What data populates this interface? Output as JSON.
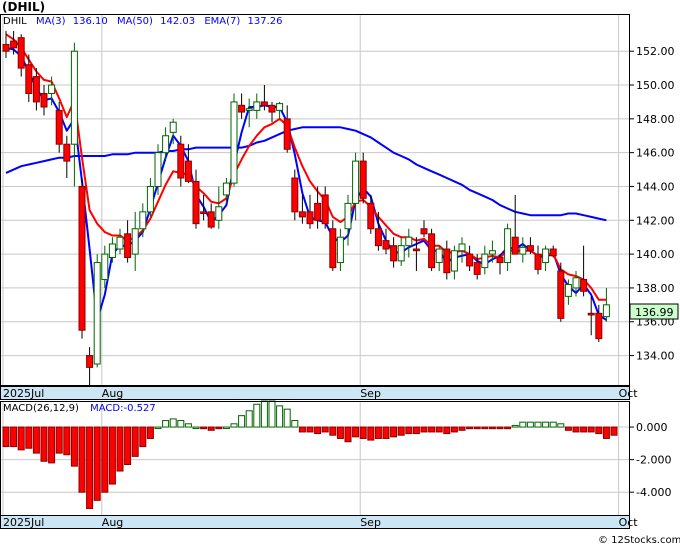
{
  "title": "(DHIL)",
  "footer": "© 12Stocks.com",
  "colors": {
    "ma3": "#0000ff",
    "ma50": "#0000ff",
    "ema7": "#ff0000",
    "up": "#006400",
    "down": "#ff0000",
    "axis_bg": "#cce6f5",
    "price_tag_bg": "#ccffcc",
    "grid": "#c8c8c8"
  },
  "legend": {
    "symbol": "DHIL",
    "ma3_label": "MA(3)",
    "ma3_value": "136.10",
    "ma50_label": "MA(50)",
    "ma50_value": "142.03",
    "ema7_label": "EMA(7)",
    "ema7_value": "137.26"
  },
  "last_price": "136.99",
  "macd_legend": {
    "label": "MACD(26,12,9)",
    "value_label": "MACD:-0.527"
  },
  "chart_data": [
    {
      "type": "candlestick",
      "title": "(DHIL)",
      "xlabel": "",
      "ylabel": "",
      "ylim": [
        132.2,
        154.2
      ],
      "y_ticks": [
        "152.00",
        "150.00",
        "148.00",
        "146.00",
        "144.00",
        "142.00",
        "140.00",
        "138.00",
        "136.00",
        "134.00"
      ],
      "x_tick_labels": [
        "2025Jul",
        "Aug",
        "Sep",
        "Oct"
      ],
      "x_tick_index": [
        0,
        13,
        47,
        81
      ],
      "grid": true,
      "ohlc": [
        [
          152.4,
          153.2,
          151.6,
          152.0
        ],
        [
          152.6,
          153.2,
          151.8,
          152.2
        ],
        [
          152.8,
          153.0,
          150.5,
          151.0
        ],
        [
          151.2,
          151.8,
          149.0,
          149.5
        ],
        [
          150.5,
          151.0,
          148.5,
          149.0
        ],
        [
          149.5,
          150.0,
          148.2,
          148.7
        ],
        [
          149.5,
          150.5,
          148.8,
          150.0
        ],
        [
          148.5,
          149.0,
          146.0,
          146.5
        ],
        [
          146.5,
          147.0,
          144.5,
          145.5
        ],
        [
          146.5,
          152.5,
          144.0,
          152.0
        ],
        [
          144.0,
          144.5,
          135.0,
          135.5
        ],
        [
          134.0,
          134.5,
          132.0,
          133.3
        ],
        [
          133.5,
          140.0,
          133.3,
          139.5
        ],
        [
          138.5,
          140.5,
          138.0,
          140.0
        ],
        [
          139.8,
          141.0,
          139.5,
          140.6
        ],
        [
          140.3,
          141.5,
          140.0,
          141.0
        ],
        [
          141.2,
          142.0,
          139.5,
          139.8
        ],
        [
          140.0,
          142.5,
          139.0,
          141.5
        ],
        [
          141.5,
          143.0,
          141.0,
          142.5
        ],
        [
          142.5,
          144.5,
          142.2,
          144.0
        ],
        [
          144.0,
          146.5,
          143.5,
          146.0
        ],
        [
          146.0,
          147.5,
          145.5,
          147.0
        ],
        [
          147.2,
          148.0,
          146.5,
          147.8
        ],
        [
          146.5,
          147.0,
          144.0,
          144.5
        ],
        [
          145.5,
          146.5,
          144.2,
          144.3
        ],
        [
          144.3,
          145.0,
          141.5,
          141.8
        ],
        [
          142.5,
          143.5,
          142.0,
          142.4
        ],
        [
          142.5,
          143.0,
          141.5,
          141.6
        ],
        [
          142.0,
          144.0,
          141.5,
          142.8
        ],
        [
          143.5,
          144.5,
          143.0,
          144.2
        ],
        [
          144.2,
          149.5,
          144.0,
          149.0
        ],
        [
          148.8,
          149.5,
          148.0,
          148.4
        ],
        [
          148.5,
          149.2,
          147.5,
          148.6
        ],
        [
          148.5,
          149.5,
          148.0,
          149.0
        ],
        [
          149.0,
          150.0,
          148.5,
          148.8
        ],
        [
          148.8,
          149.0,
          147.8,
          148.4
        ],
        [
          148.5,
          149.0,
          148.0,
          148.9
        ],
        [
          148.0,
          148.8,
          146.0,
          146.2
        ],
        [
          144.5,
          145.0,
          142.0,
          142.5
        ],
        [
          142.5,
          143.5,
          141.8,
          142.2
        ],
        [
          142.5,
          143.5,
          141.5,
          141.8
        ],
        [
          143.0,
          144.0,
          141.5,
          142.0
        ],
        [
          143.5,
          144.0,
          141.5,
          141.8
        ],
        [
          141.5,
          142.0,
          139.0,
          139.2
        ],
        [
          139.5,
          141.5,
          139.0,
          141.0
        ],
        [
          141.5,
          143.5,
          140.5,
          143.0
        ],
        [
          143.0,
          146.0,
          142.0,
          145.5
        ],
        [
          145.5,
          146.0,
          143.0,
          143.3
        ],
        [
          143.0,
          143.5,
          141.2,
          141.5
        ],
        [
          141.5,
          142.5,
          140.2,
          140.5
        ],
        [
          140.8,
          141.5,
          140.0,
          140.3
        ],
        [
          140.5,
          141.0,
          139.2,
          139.6
        ],
        [
          139.6,
          141.0,
          139.3,
          140.5
        ],
        [
          140.5,
          141.5,
          139.8,
          141.0
        ],
        [
          140.3,
          141.0,
          139.0,
          140.2
        ],
        [
          141.5,
          142.0,
          141.0,
          141.2
        ],
        [
          141.2,
          141.5,
          139.0,
          139.2
        ],
        [
          139.5,
          140.5,
          139.0,
          140.3
        ],
        [
          140.3,
          140.8,
          138.5,
          138.9
        ],
        [
          139.0,
          140.5,
          138.5,
          140.2
        ],
        [
          140.2,
          141.0,
          139.5,
          140.6
        ],
        [
          140.0,
          140.5,
          139.0,
          139.3
        ],
        [
          139.5,
          140.0,
          138.5,
          138.8
        ],
        [
          139.2,
          140.5,
          138.8,
          140.0
        ],
        [
          140.0,
          140.8,
          139.5,
          140.2
        ],
        [
          139.8,
          140.0,
          138.8,
          139.5
        ],
        [
          139.5,
          141.8,
          139.0,
          141.5
        ],
        [
          141.0,
          143.5,
          140.5,
          140.0
        ],
        [
          140.0,
          141.0,
          139.5,
          140.4
        ],
        [
          140.5,
          141.0,
          140.0,
          140.2
        ],
        [
          140.0,
          140.5,
          138.8,
          139.1
        ],
        [
          139.5,
          140.5,
          139.0,
          140.3
        ],
        [
          140.3,
          140.5,
          139.8,
          139.9
        ],
        [
          139.0,
          139.5,
          136.0,
          136.2
        ],
        [
          137.5,
          138.5,
          137.0,
          138.2
        ],
        [
          138.0,
          139.0,
          137.5,
          138.6
        ],
        [
          138.5,
          140.5,
          137.5,
          137.8
        ],
        [
          136.5,
          137.5,
          135.2,
          136.4
        ],
        [
          136.5,
          137.0,
          134.8,
          135.0
        ],
        [
          136.3,
          138.0,
          136.0,
          137.0
        ]
      ],
      "series": [
        {
          "name": "MA(3)",
          "values": [
            152.2,
            152.1,
            151.7,
            150.8,
            149.8,
            149.1,
            149.2,
            148.4,
            147.3,
            148.0,
            144.3,
            140.3,
            136.1,
            137.6,
            140.0,
            140.5,
            140.5,
            140.8,
            141.3,
            142.7,
            144.2,
            145.7,
            147.0,
            146.4,
            145.5,
            143.5,
            142.8,
            141.9,
            142.3,
            142.9,
            145.3,
            147.2,
            148.7,
            148.7,
            148.8,
            148.7,
            148.7,
            147.8,
            145.9,
            143.6,
            142.2,
            142.0,
            141.9,
            141.0,
            140.7,
            141.1,
            143.2,
            143.9,
            143.4,
            141.8,
            140.8,
            140.1,
            140.1,
            140.4,
            140.6,
            140.8,
            140.2,
            140.2,
            139.5,
            139.8,
            139.9,
            140.0,
            139.6,
            139.4,
            139.7,
            139.9,
            140.4,
            140.3,
            140.6,
            140.2,
            139.9,
            139.8,
            140.1,
            138.8,
            138.1,
            137.7,
            138.2,
            137.6,
            136.4,
            136.1
          ]
        },
        {
          "name": "MA(50)",
          "values": [
            144.8,
            145.0,
            145.2,
            145.3,
            145.4,
            145.5,
            145.6,
            145.7,
            145.7,
            145.8,
            145.8,
            145.8,
            145.8,
            145.8,
            145.9,
            145.9,
            145.9,
            146.0,
            146.0,
            146.0,
            146.0,
            146.1,
            146.1,
            146.2,
            146.2,
            146.3,
            146.3,
            146.3,
            146.3,
            146.3,
            146.3,
            146.3,
            146.4,
            146.6,
            146.7,
            146.9,
            147.1,
            147.3,
            147.4,
            147.5,
            147.5,
            147.5,
            147.5,
            147.5,
            147.5,
            147.4,
            147.3,
            147.1,
            146.9,
            146.6,
            146.3,
            146.0,
            145.8,
            145.6,
            145.3,
            145.1,
            144.9,
            144.7,
            144.5,
            144.3,
            144.1,
            143.8,
            143.6,
            143.4,
            143.2,
            142.9,
            142.7,
            142.5,
            142.4,
            142.3,
            142.3,
            142.3,
            142.3,
            142.3,
            142.4,
            142.4,
            142.3,
            142.2,
            142.1,
            142.0
          ]
        },
        {
          "name": "EMA(7)",
          "values": [
            153.0,
            152.7,
            152.2,
            151.5,
            150.8,
            150.3,
            150.2,
            149.2,
            148.1,
            149.1,
            145.7,
            142.6,
            141.8,
            141.3,
            141.1,
            141.1,
            140.8,
            141.0,
            141.4,
            142.1,
            143.1,
            144.1,
            144.9,
            144.8,
            144.7,
            144.0,
            143.6,
            143.1,
            143.0,
            143.3,
            144.7,
            145.6,
            146.4,
            147.0,
            147.5,
            147.7,
            148.0,
            147.6,
            146.3,
            145.2,
            144.3,
            143.7,
            143.2,
            142.2,
            141.9,
            142.2,
            143.1,
            143.2,
            142.8,
            142.2,
            141.7,
            141.2,
            141.0,
            141.0,
            140.8,
            140.9,
            140.5,
            140.5,
            140.1,
            140.1,
            140.2,
            140.0,
            139.7,
            139.8,
            139.9,
            139.8,
            140.2,
            140.2,
            140.2,
            140.2,
            139.9,
            140.0,
            140.0,
            139.1,
            138.8,
            138.7,
            138.5,
            138.0,
            137.3,
            137.3
          ]
        }
      ]
    },
    {
      "type": "bar",
      "title": "MACD(26,12,9)",
      "ylim": [
        -5.4,
        1.6
      ],
      "y_ticks": [
        "0.000",
        "-2.000",
        "-4.000"
      ],
      "x_tick_labels": [
        "2025Jul",
        "Aug",
        "Sep",
        "Oct"
      ],
      "x_tick_index": [
        0,
        13,
        47,
        81
      ],
      "series": [
        {
          "name": "MACD",
          "values": [
            -1.2,
            -1.2,
            -1.4,
            -1.3,
            -1.6,
            -2.1,
            -2.2,
            -1.6,
            -1.7,
            -2.4,
            -4.0,
            -5.0,
            -4.5,
            -4.0,
            -3.5,
            -2.7,
            -2.3,
            -1.8,
            -1.2,
            -0.7,
            0.0,
            0.4,
            0.5,
            0.4,
            0.2,
            0.0,
            -0.1,
            -0.2,
            -0.1,
            0.0,
            0.2,
            0.7,
            1.0,
            1.4,
            1.6,
            1.6,
            1.3,
            1.1,
            0.4,
            -0.3,
            -0.3,
            -0.4,
            -0.3,
            -0.5,
            -0.7,
            -0.9,
            -0.6,
            -0.7,
            -0.8,
            -0.7,
            -0.7,
            -0.6,
            -0.5,
            -0.4,
            -0.4,
            -0.3,
            -0.3,
            -0.3,
            -0.4,
            -0.3,
            -0.2,
            -0.1,
            -0.1,
            -0.1,
            -0.1,
            -0.1,
            -0.1,
            0.1,
            0.3,
            0.3,
            0.3,
            0.3,
            0.3,
            0.2,
            -0.2,
            -0.3,
            -0.3,
            -0.3,
            -0.4,
            -0.7,
            -0.5
          ]
        }
      ]
    }
  ]
}
